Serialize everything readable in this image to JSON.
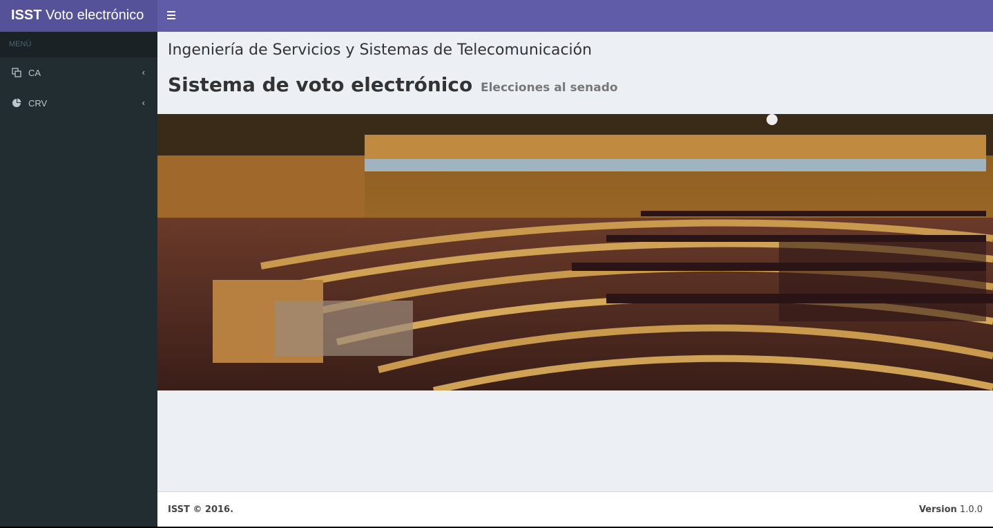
{
  "brand": {
    "bold": "ISST",
    "text": "Voto electrónico"
  },
  "sidebar": {
    "header": "MENÚ",
    "items": [
      {
        "label": "CA",
        "icon": "clone-icon"
      },
      {
        "label": "CRV",
        "icon": "pie-chart-icon"
      }
    ]
  },
  "content": {
    "org_title": "Ingeniería de Servicios y Sistemas de Telecomunicación",
    "title": "Sistema de voto electrónico",
    "subtitle": "Elecciones al senado",
    "hero_alt": "senate-chamber-photo"
  },
  "footer": {
    "copyright": "ISST © 2016.",
    "version_label": "Version",
    "version": "1.0.0"
  },
  "colors": {
    "navbar": "#605ca8",
    "logo": "#555299",
    "sidebar": "#222d32",
    "content_bg": "#ecf0f5"
  }
}
